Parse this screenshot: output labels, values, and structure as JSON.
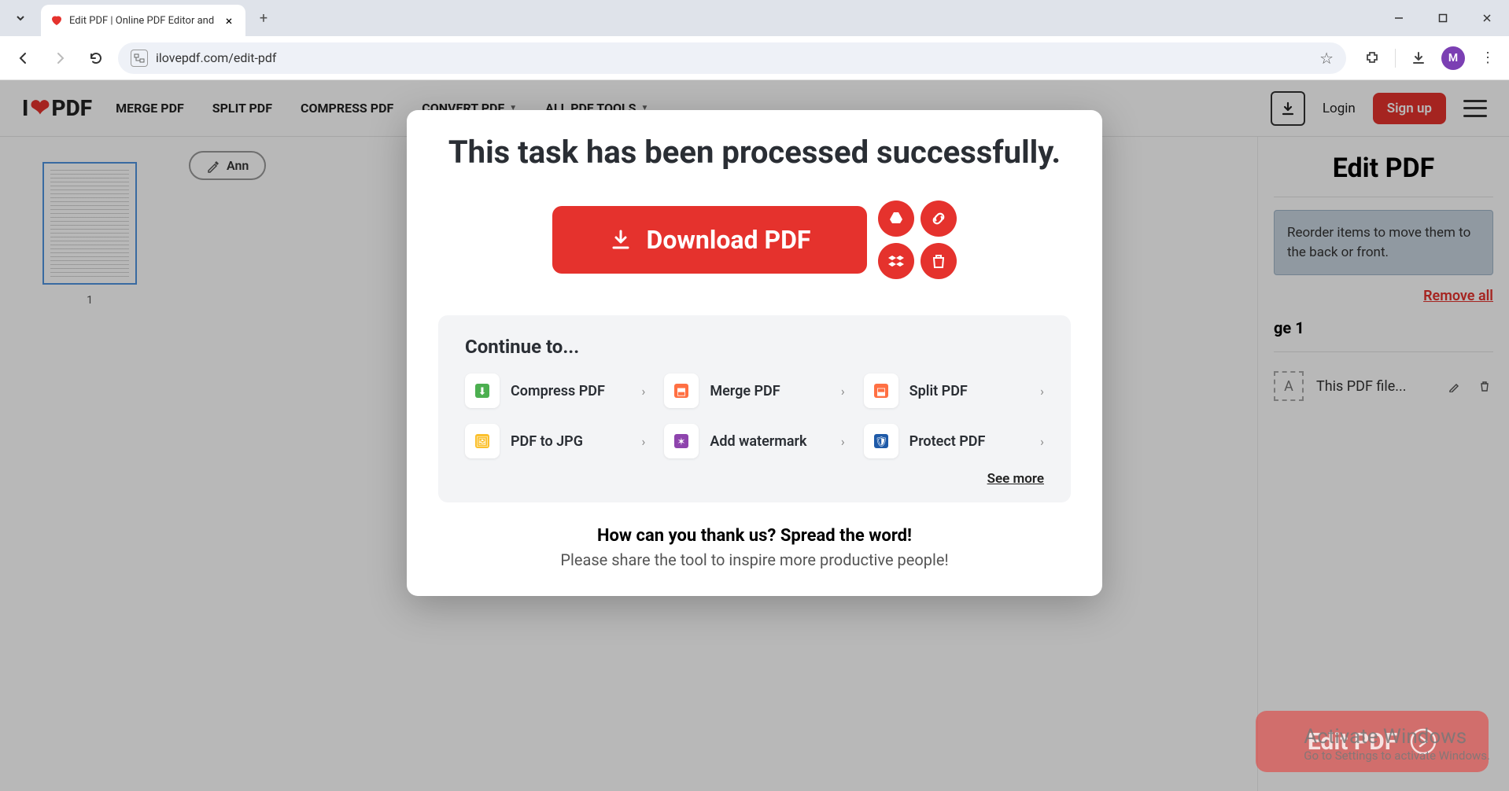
{
  "browser": {
    "tab_title": "Edit PDF | Online PDF Editor and",
    "url": "ilovepdf.com/edit-pdf",
    "avatar_initial": "M"
  },
  "header": {
    "logo_parts": {
      "pre": "I",
      "post": "PDF"
    },
    "nav": {
      "merge": "MERGE PDF",
      "split": "SPLIT PDF",
      "compress": "COMPRESS PDF",
      "convert": "CONVERT PDF",
      "all_tools": "ALL PDF TOOLS"
    },
    "login": "Login",
    "signup": "Sign up"
  },
  "thumbnails": {
    "page_label": "1"
  },
  "canvas": {
    "annotate": "Ann"
  },
  "right_panel": {
    "title": "Edit PDF",
    "info": "Reorder items to move them to the back or front.",
    "remove_all": "Remove all",
    "page_section": "ge 1",
    "layer_name": "This PDF file..."
  },
  "fab": {
    "label": "Edit PDF"
  },
  "modal": {
    "title": "This task has been processed successfully.",
    "download": "Download PDF",
    "continue_title": "Continue to...",
    "tools": [
      {
        "label": "Compress PDF",
        "icon_color": "#4caf50",
        "glyph": "⬇"
      },
      {
        "label": "Merge PDF",
        "icon_color": "#ff7043",
        "glyph": "⬒"
      },
      {
        "label": "Split PDF",
        "icon_color": "#ff7043",
        "glyph": "⬓"
      },
      {
        "label": "PDF to JPG",
        "icon_color": "#fbc02d",
        "glyph": "🖼"
      },
      {
        "label": "Add watermark",
        "icon_color": "#8e44ad",
        "glyph": "✶"
      },
      {
        "label": "Protect PDF",
        "icon_color": "#1e5aa8",
        "glyph": "🛡"
      }
    ],
    "see_more": "See more",
    "thanks_title": "How can you thank us? Spread the word!",
    "thanks_sub": "Please share the tool to inspire more productive people!"
  },
  "watermark": {
    "title": "Activate Windows",
    "sub": "Go to Settings to activate Windows."
  }
}
